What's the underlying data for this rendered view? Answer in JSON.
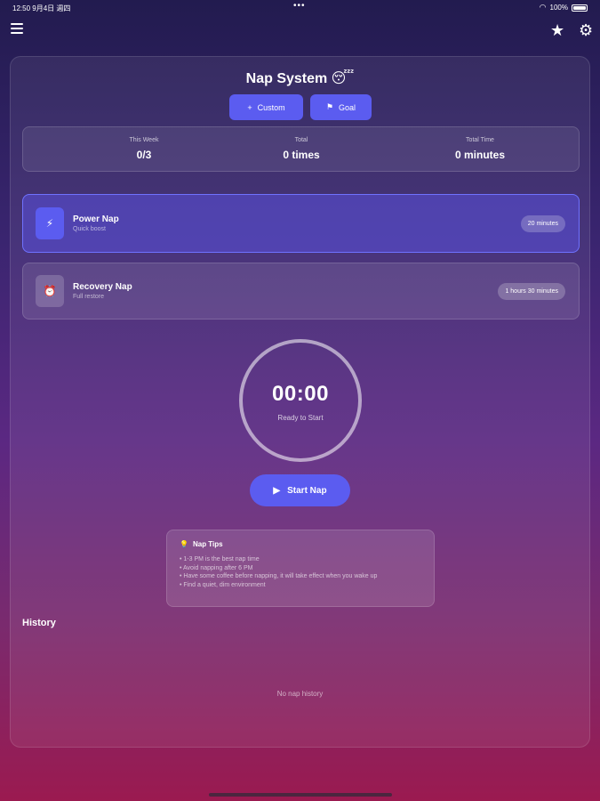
{
  "status_bar": {
    "time_date": "12:50  9月4日 週四",
    "dots": "•••",
    "battery_pct": "100%"
  },
  "header": {
    "menu_icon": "menu-icon",
    "star_icon": "star-icon",
    "settings_icon": "gear-icon"
  },
  "title": "Nap System 😴",
  "buttons": {
    "custom": "Custom",
    "custom_icon": "+",
    "goal": "Goal",
    "goal_icon": "⚑"
  },
  "stats": [
    {
      "label": "This Week",
      "value": "0/3"
    },
    {
      "label": "Total",
      "value": "0 times"
    },
    {
      "label": "Total Time",
      "value": "0 minutes"
    }
  ],
  "nap_options": [
    {
      "name": "Power Nap",
      "subtitle": "Quick boost",
      "duration": "20 minutes",
      "icon": "⚡",
      "selected": true
    },
    {
      "name": "Recovery Nap",
      "subtitle": "Full restore",
      "duration": "1 hours 30 minutes",
      "icon": "⏰",
      "selected": false
    }
  ],
  "timer": {
    "time": "00:00",
    "status": "Ready to Start"
  },
  "start_button": {
    "label": "Start Nap",
    "icon": "▶"
  },
  "tips": {
    "icon": "💡",
    "title": "Nap Tips",
    "items": [
      "• 1-3 PM is the best nap time",
      "• Avoid napping after 6 PM",
      "• Have some coffee before napping, it will take effect when you wake up",
      "• Find a quiet, dim environment"
    ]
  },
  "history": {
    "heading": "History",
    "empty": "No nap history"
  },
  "colors": {
    "accent": "#5b5cf0",
    "background_top": "#221b4f",
    "background_bottom": "#9b1a50"
  }
}
